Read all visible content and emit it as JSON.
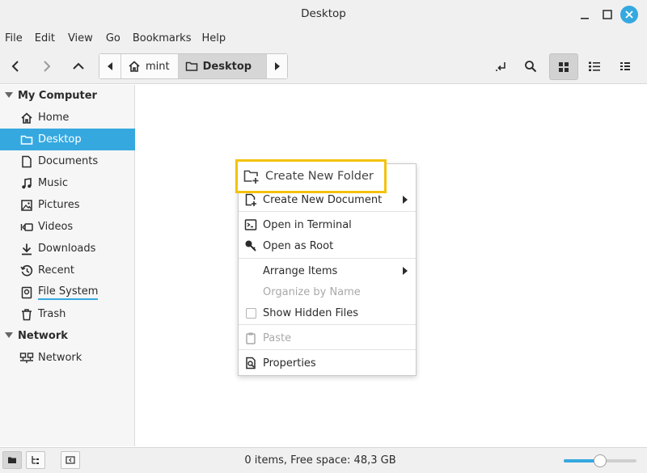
{
  "window": {
    "title": "Desktop"
  },
  "menubar": [
    "File",
    "Edit",
    "View",
    "Go",
    "Bookmarks",
    "Help"
  ],
  "pathbar": {
    "home_label": "mint",
    "current_label": "Desktop"
  },
  "sidebar": {
    "sections": [
      {
        "header": "My Computer",
        "items": [
          "Home",
          "Desktop",
          "Documents",
          "Music",
          "Pictures",
          "Videos",
          "Downloads",
          "Recent",
          "File System",
          "Trash"
        ]
      },
      {
        "header": "Network",
        "items": [
          "Network"
        ]
      }
    ],
    "selected": "Desktop"
  },
  "context_menu": {
    "highlighted": "Create New Folder",
    "items": [
      {
        "label": "Create New Document",
        "submenu": true,
        "disabled": false
      },
      {
        "label": "Open in Terminal",
        "disabled": false
      },
      {
        "label": "Open as Root",
        "disabled": false
      },
      {
        "label": "Arrange Items",
        "submenu": true,
        "disabled": false
      },
      {
        "label": "Organize by Name",
        "disabled": true
      },
      {
        "label": "Show Hidden Files",
        "disabled": false,
        "checkbox": true,
        "checked": false
      },
      {
        "label": "Paste",
        "disabled": true
      },
      {
        "label": "Properties",
        "disabled": false
      }
    ]
  },
  "statusbar": {
    "text": "0 items, Free space: 48,3 GB",
    "zoom_level": 0.5
  },
  "colors": {
    "accent": "#35a8e0",
    "highlight_border": "#f4c20d"
  }
}
